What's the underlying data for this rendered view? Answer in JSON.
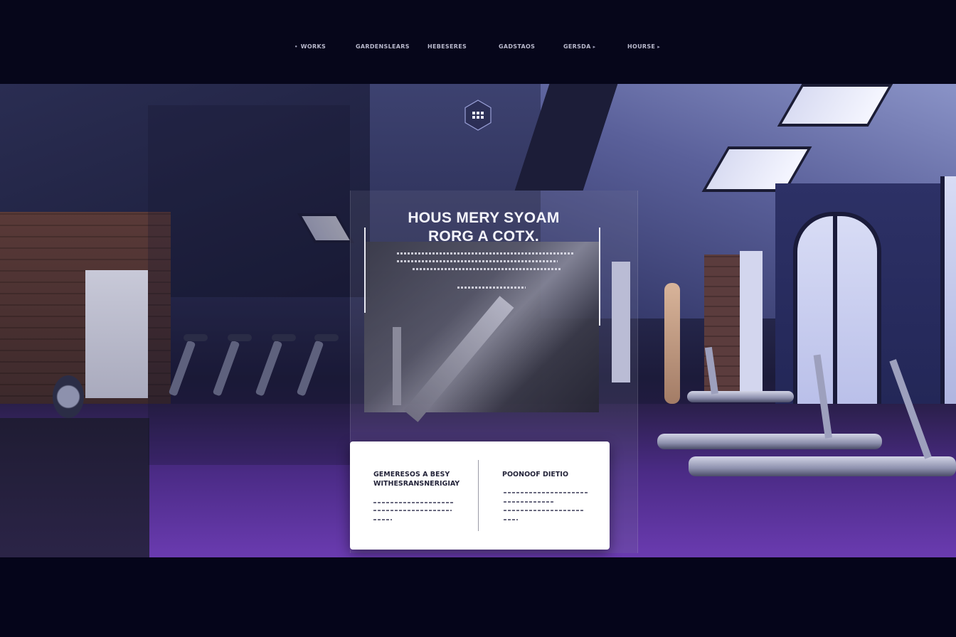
{
  "nav": {
    "items": [
      {
        "label": "WORKS",
        "prefix": "•",
        "caret": ""
      },
      {
        "label": "GARDENSLEARS",
        "prefix": "",
        "caret": ""
      },
      {
        "label": "HEBESERES",
        "prefix": "",
        "caret": ""
      },
      {
        "label": "GADSTAOS",
        "prefix": "",
        "caret": ""
      },
      {
        "label": "GERSDA",
        "prefix": "",
        "caret": "▸"
      },
      {
        "label": "HOURSE",
        "prefix": "",
        "caret": "▸"
      }
    ]
  },
  "hero": {
    "logo_icon": "hexagon-grid-logo-icon",
    "title_line1": "HOUS MERY SYOAM",
    "title_line2": "RORG A COTX."
  },
  "card": {
    "left_title_line1": "GEMERESOS A BESY",
    "left_title_line2": "WITHESRANSNERIGIAY",
    "right_title": "POONOOF DIETIO"
  },
  "colors": {
    "background": "#07071a",
    "accent_purple": "#6a3bb0",
    "card_bg": "#ffffff"
  }
}
